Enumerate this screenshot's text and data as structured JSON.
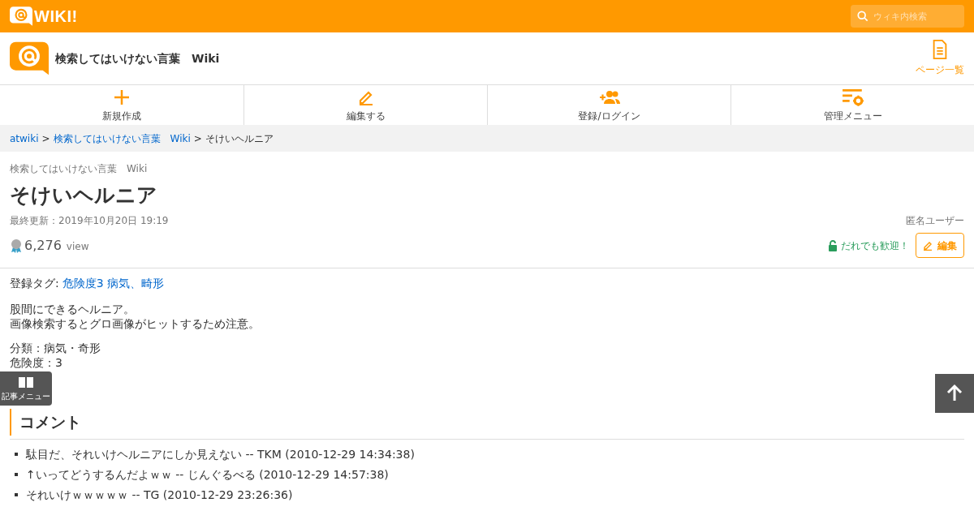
{
  "topbar": {
    "logo_text": "WIKI!",
    "search": {
      "placeholder": "ウィキ内検索"
    }
  },
  "site": {
    "title": "検索してはいけない言葉　Wiki",
    "page_list": "ページ一覧"
  },
  "nav": [
    {
      "kind": "plus",
      "label": "新規作成"
    },
    {
      "kind": "pencil",
      "label": "編集する"
    },
    {
      "kind": "user",
      "label": "登録/ログイン"
    },
    {
      "kind": "admin",
      "label": "管理メニュー"
    }
  ],
  "breadcrumb": {
    "links": [
      "atwiki",
      "検索してはいけない言葉　Wiki"
    ],
    "separator": ">",
    "current": "そけいヘルニア"
  },
  "page": {
    "wiki_name": "検索してはいけない言葉　Wiki",
    "title": "そけいヘルニア",
    "updated": "最終更新：2019年10月20日 19:19",
    "author": "匿名ユーザー",
    "views": "6,276",
    "views_unit": "view",
    "welcome": "だれでも歓迎！",
    "edit_button": "編集"
  },
  "tags": {
    "label": "登録タグ:",
    "items": [
      "危険度3",
      "病気、畸形"
    ]
  },
  "paragraphs": [
    [
      "股間にできるヘルニア。",
      "画像検索するとグロ画像がヒットするため注意。"
    ],
    [
      "分類：病気・奇形",
      "危険度：3"
    ]
  ],
  "article_menu": "記事メニュー",
  "comments": {
    "heading": "コメント",
    "items": [
      "駄目だ、それいけヘルニアにしか見えない -- TKM (2010-12-29 14:34:38)",
      "↑いってどうするんだよｗｗ -- じんぐるべる (2010-12-29 14:57:38)",
      "それいけｗｗｗｗｗ -- TG (2010-12-29 23:26:36)"
    ]
  }
}
